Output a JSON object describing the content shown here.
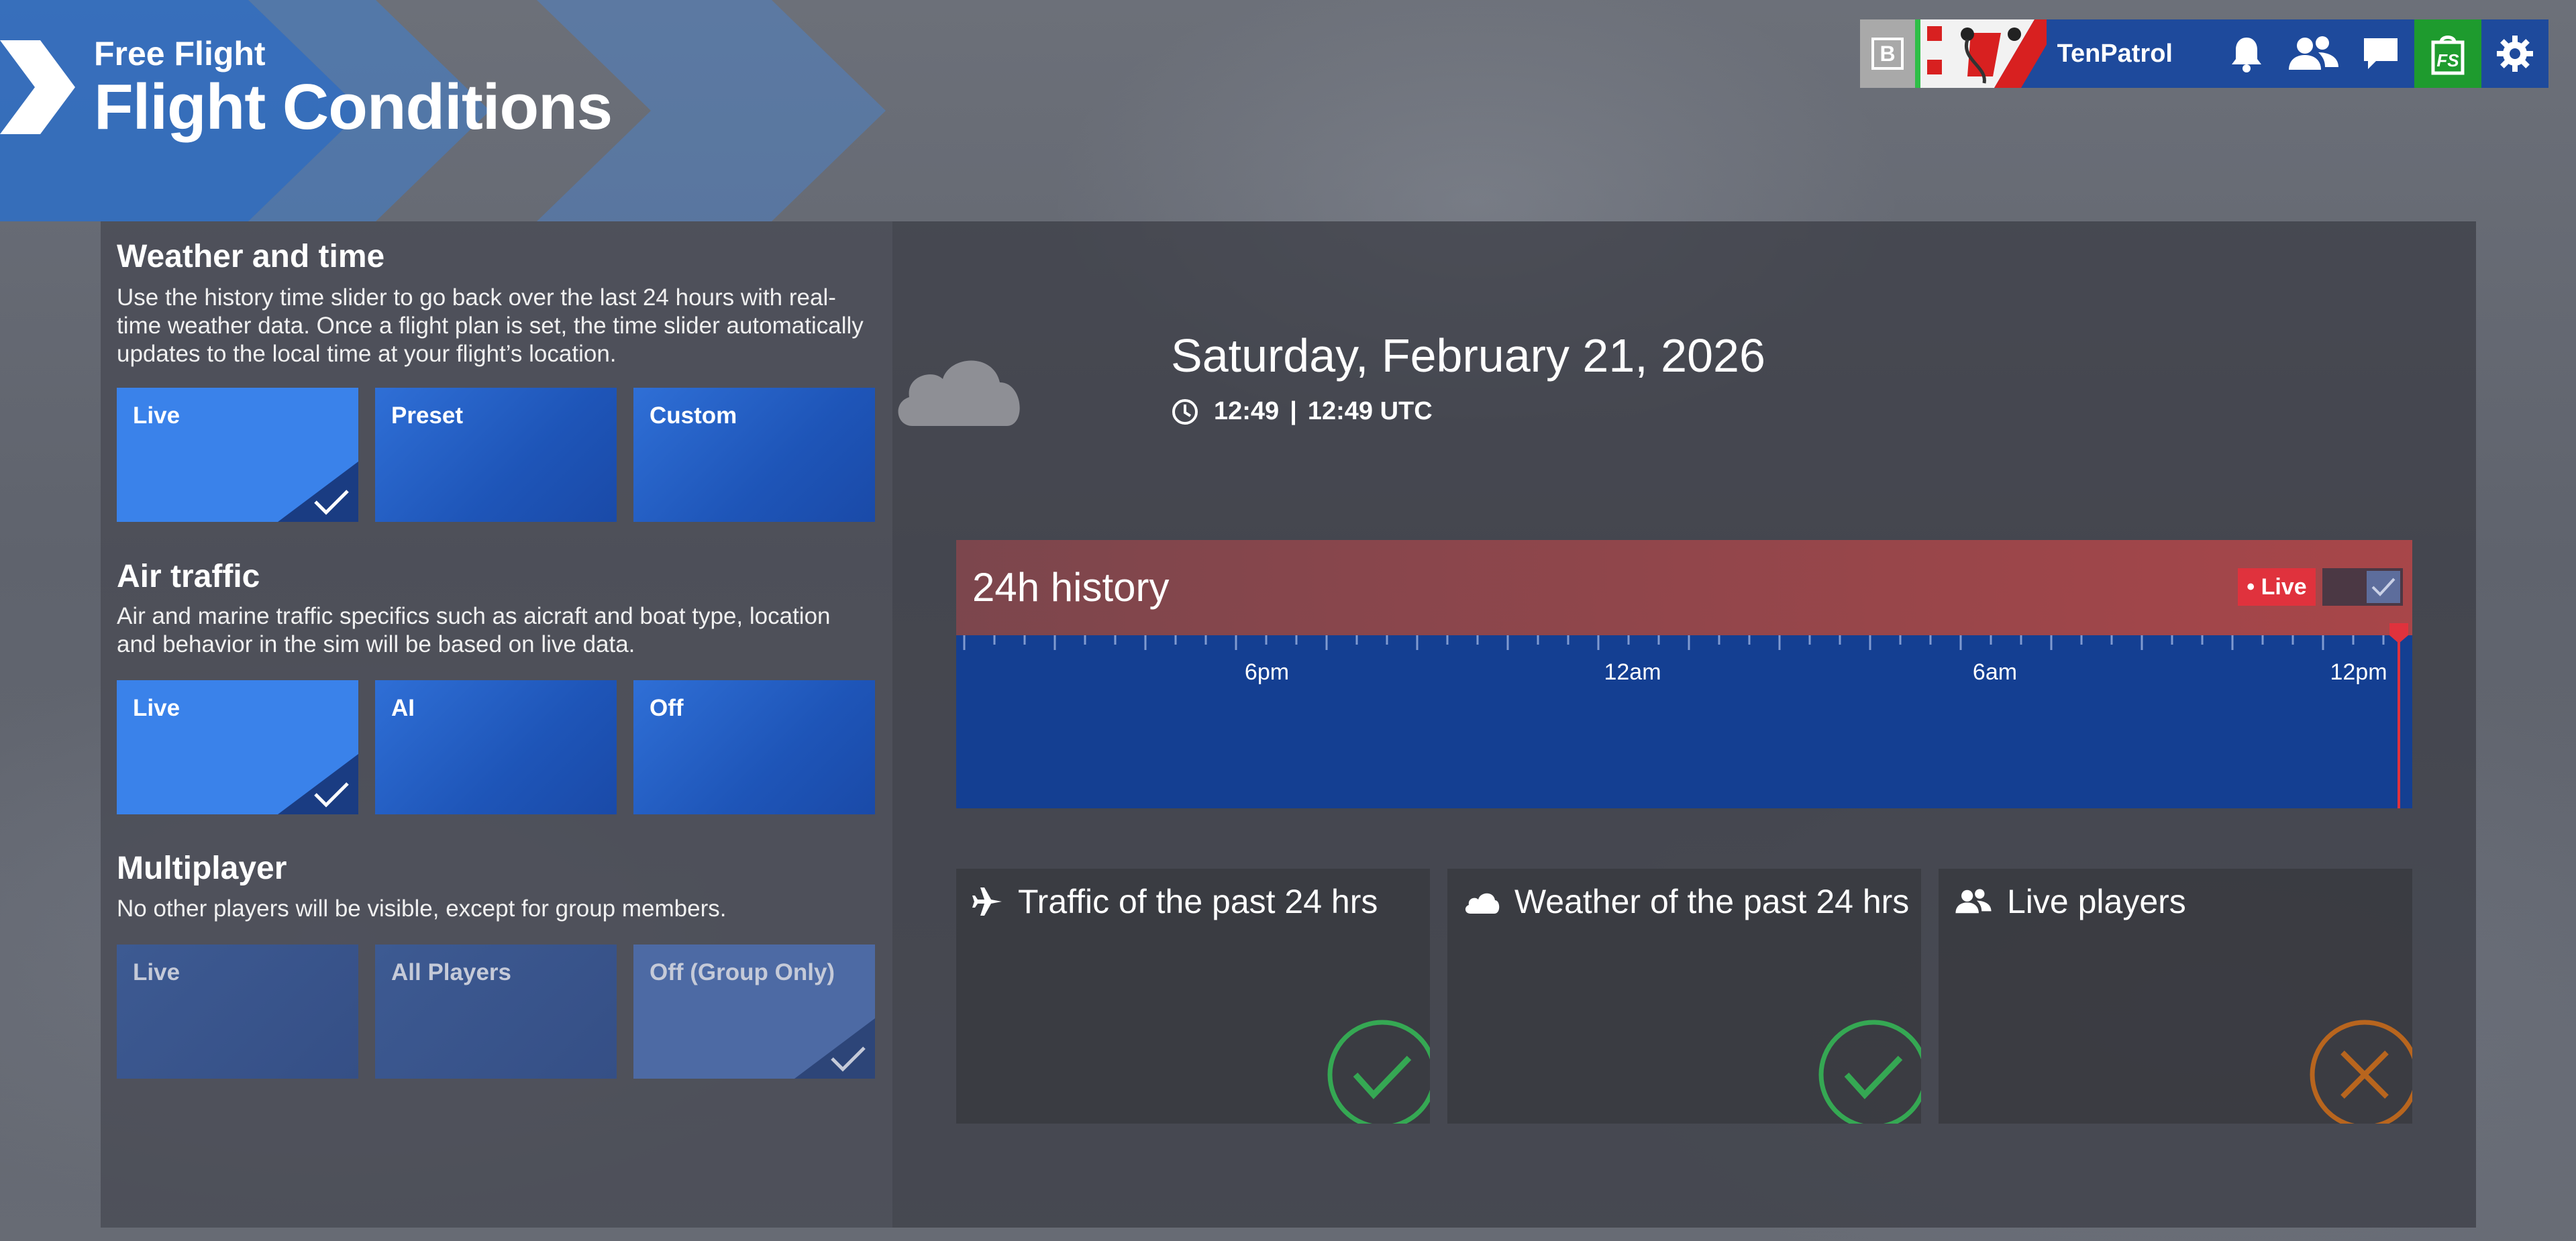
{
  "header": {
    "subtitle": "Free Flight",
    "title": "Flight Conditions"
  },
  "topbar": {
    "badge_letter": "B",
    "username": "TenPatrol",
    "store_label": "FS",
    "icons": [
      "bell-icon",
      "friends-icon",
      "chat-icon",
      "store-icon",
      "gear-icon"
    ]
  },
  "weather": {
    "title": "Weather and time",
    "description": "Use the history time slider to go back over the last 24 hours with real-time weather data. Once a flight plan is set, the time slider automatically updates to the local time at your flight’s location.",
    "options": [
      {
        "label": "Live",
        "selected": true
      },
      {
        "label": "Preset",
        "selected": false
      },
      {
        "label": "Custom",
        "selected": false
      }
    ]
  },
  "air_traffic": {
    "title": "Air traffic",
    "description": "Air and marine traffic specifics such as aicraft and boat type, location and behavior in the sim will be based on live data.",
    "options": [
      {
        "label": "Live",
        "selected": true
      },
      {
        "label": "AI",
        "selected": false
      },
      {
        "label": "Off",
        "selected": false
      }
    ]
  },
  "multiplayer": {
    "title": "Multiplayer",
    "description": "No other players will be visible, except for group members.",
    "options": [
      {
        "label": "Live",
        "selected": false
      },
      {
        "label": "All Players",
        "selected": false
      },
      {
        "label": "Off (Group Only)",
        "selected": true
      }
    ]
  },
  "datetime": {
    "date": "Saturday, February 21, 2026",
    "local_time": "12:49",
    "separator": "|",
    "utc_time": "12:49 UTC"
  },
  "history": {
    "title": "24h history",
    "live_badge": "• Live",
    "live_toggle_on": true,
    "tick_labels": [
      "6pm",
      "12am",
      "6am",
      "12pm"
    ]
  },
  "cards": [
    {
      "title": "Traffic of the past 24 hrs",
      "icon": "airplane-icon",
      "status": "available",
      "color": "#35a853"
    },
    {
      "title": "Weather of the past 24 hrs",
      "icon": "cloud-icon",
      "status": "available",
      "color": "#35a853"
    },
    {
      "title": "Live players",
      "icon": "players-icon",
      "status": "unavailable",
      "color": "#b8651e"
    }
  ]
}
